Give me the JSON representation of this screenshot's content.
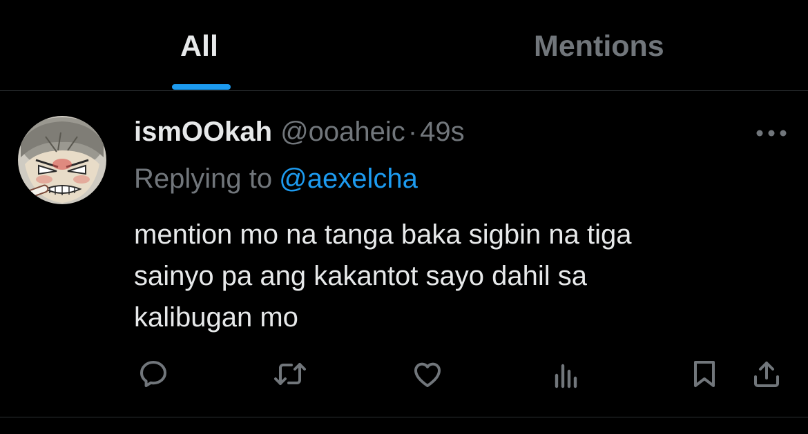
{
  "tabs": [
    {
      "label": "All",
      "active": true
    },
    {
      "label": "Mentions",
      "active": false
    }
  ],
  "tweet": {
    "display_name": "ismOOkah",
    "handle": "@ooaheic",
    "separator": "·",
    "time": "49s",
    "reply_prefix": "Replying to",
    "reply_target": "@aexelcha",
    "text_lines": [
      "mention mo na tanga baka sigbin na tiga",
      "sainyo pa ang kakantot sayo dahil sa",
      "kalibugan mo"
    ]
  },
  "actions": [
    {
      "icon": "reply-icon"
    },
    {
      "icon": "retweet-icon"
    },
    {
      "icon": "like-icon"
    },
    {
      "icon": "views-icon"
    },
    {
      "icon": "bookmark-icon"
    },
    {
      "icon": "share-icon"
    }
  ],
  "colors": {
    "background": "#000000",
    "primary_text": "#e7e9ea",
    "secondary_text": "#71767b",
    "accent": "#1d9bf0",
    "divider": "#2f3336"
  }
}
